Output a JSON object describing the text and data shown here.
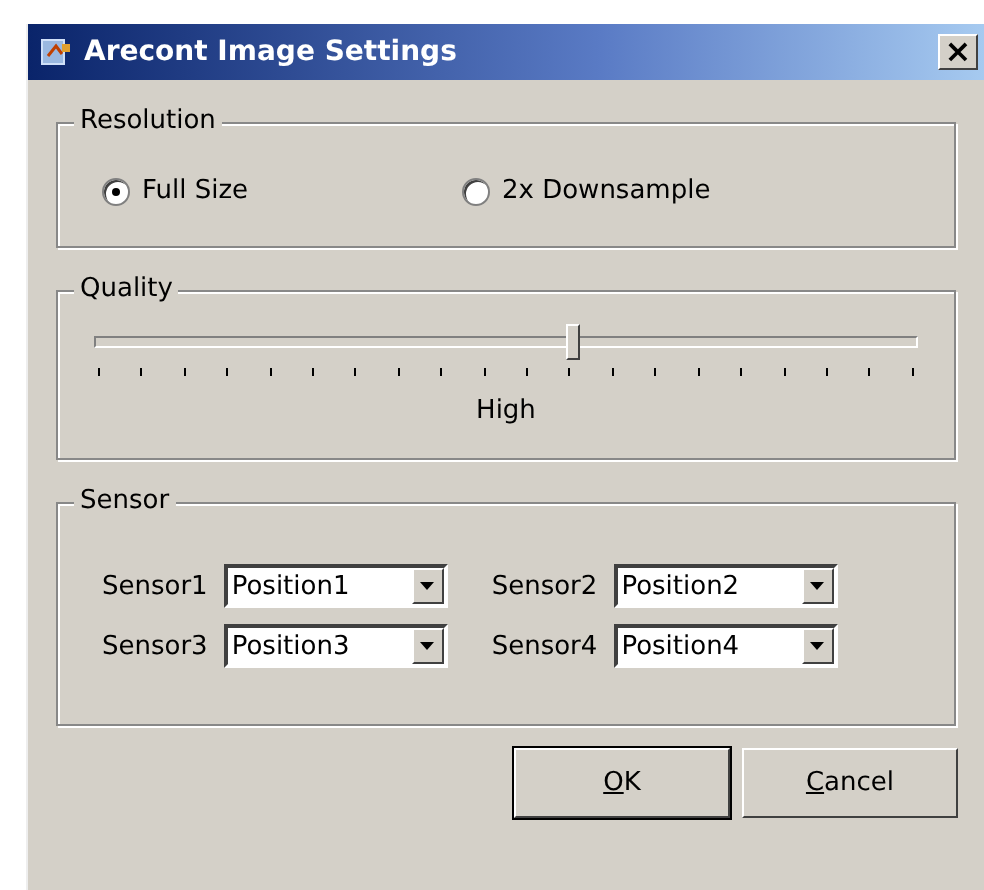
{
  "window": {
    "title": "Arecont Image Settings",
    "close": "×"
  },
  "resolution": {
    "title": "Resolution",
    "options": [
      {
        "label": "Full Size",
        "selected": true
      },
      {
        "label": "2x Downsample",
        "selected": false
      }
    ]
  },
  "quality": {
    "title": "Quality",
    "level": 0.58,
    "reading": "High"
  },
  "sensor": {
    "title": "Sensor",
    "rows": [
      {
        "label": "Sensor1",
        "value": "Position1"
      },
      {
        "label": "Sensor2",
        "value": "Position2"
      },
      {
        "label": "Sensor3",
        "value": "Position3"
      },
      {
        "label": "Sensor4",
        "value": "Position4"
      }
    ]
  },
  "buttons": [
    {
      "access_key": "O",
      "rest": "K",
      "default": true
    },
    {
      "access_key": "C",
      "rest": "ancel",
      "default": false
    }
  ]
}
